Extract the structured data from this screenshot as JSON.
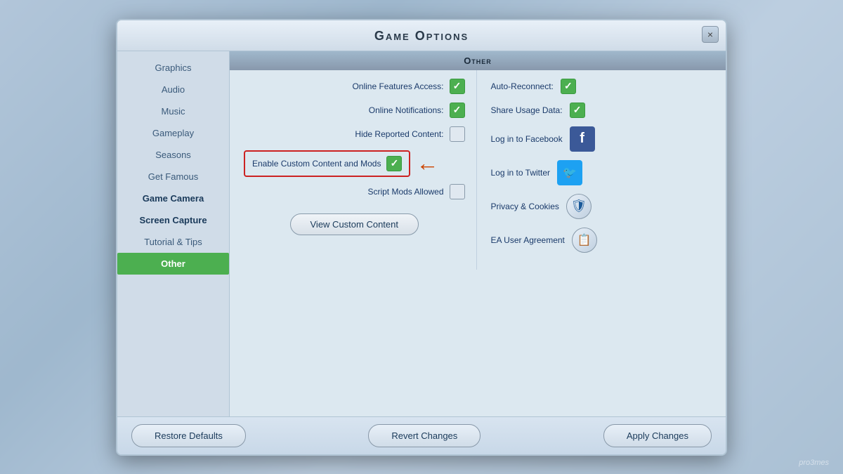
{
  "dialog": {
    "title": "Game Options",
    "close_label": "×"
  },
  "sidebar": {
    "items": [
      {
        "id": "graphics",
        "label": "Graphics",
        "active": false,
        "bold": false
      },
      {
        "id": "audio",
        "label": "Audio",
        "active": false,
        "bold": false
      },
      {
        "id": "music",
        "label": "Music",
        "active": false,
        "bold": false
      },
      {
        "id": "gameplay",
        "label": "Gameplay",
        "active": false,
        "bold": false
      },
      {
        "id": "seasons",
        "label": "Seasons",
        "active": false,
        "bold": false
      },
      {
        "id": "get-famous",
        "label": "Get Famous",
        "active": false,
        "bold": false
      },
      {
        "id": "game-camera",
        "label": "Game Camera",
        "active": false,
        "bold": true
      },
      {
        "id": "screen-capture",
        "label": "Screen Capture",
        "active": false,
        "bold": true
      },
      {
        "id": "tutorial-tips",
        "label": "Tutorial & Tips",
        "active": false,
        "bold": false
      },
      {
        "id": "other",
        "label": "Other",
        "active": true,
        "bold": false
      }
    ]
  },
  "section": {
    "header": "Other"
  },
  "left_options": [
    {
      "id": "online-features",
      "label": "Online Features Access:",
      "checked": true
    },
    {
      "id": "online-notifications",
      "label": "Online Notifications:",
      "checked": true
    },
    {
      "id": "hide-reported",
      "label": "Hide Reported Content:",
      "checked": false
    },
    {
      "id": "enable-custom",
      "label": "Enable Custom Content and Mods",
      "checked": true
    }
  ],
  "script_mods": {
    "label": "Script Mods Allowed",
    "checked": false
  },
  "view_btn": {
    "label": "View Custom Content"
  },
  "right_options": [
    {
      "id": "auto-reconnect",
      "label": "Auto-Reconnect:",
      "checked": true,
      "icon": null
    },
    {
      "id": "share-usage",
      "label": "Share Usage Data:",
      "checked": true,
      "icon": null
    },
    {
      "id": "facebook",
      "label": "Log in to Facebook",
      "checked": false,
      "icon": "facebook"
    },
    {
      "id": "twitter",
      "label": "Log in to Twitter",
      "checked": false,
      "icon": "twitter"
    },
    {
      "id": "privacy",
      "label": "Privacy & Cookies",
      "checked": false,
      "icon": "privacy"
    },
    {
      "id": "ea-agreement",
      "label": "EA User Agreement",
      "checked": false,
      "icon": "ea"
    }
  ],
  "footer": {
    "restore_label": "Restore Defaults",
    "revert_label": "Revert Changes",
    "apply_label": "Apply Changes"
  },
  "watermark": "pro3mes"
}
